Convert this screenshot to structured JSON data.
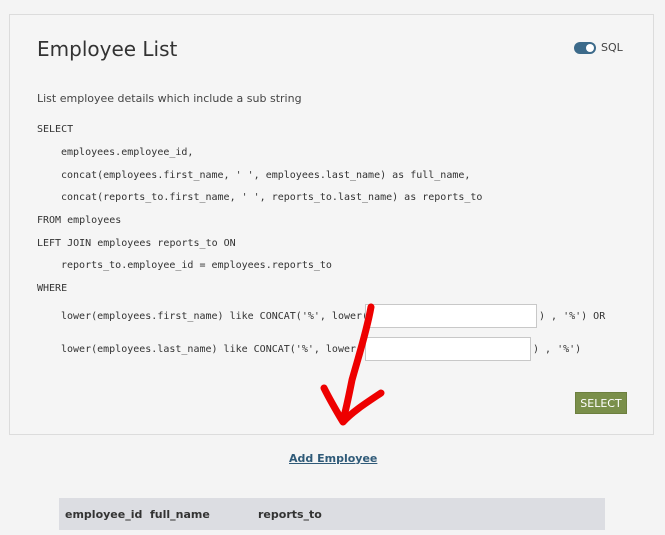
{
  "header": {
    "title": "Employee List"
  },
  "toggle": {
    "label": "SQL",
    "on": true
  },
  "description": "List employee details which include a sub string",
  "sql": {
    "line1": "SELECT",
    "line2": "employees.employee_id,",
    "line3": "concat(employees.first_name, ' ', employees.last_name) as full_name,",
    "line4": "concat(reports_to.first_name, ' ', reports_to.last_name) as reports_to",
    "line5": "FROM employees",
    "line6": "LEFT JOIN employees reports_to ON",
    "line7": "reports_to.employee_id = employees.reports_to",
    "line8": "WHERE",
    "where1_prefix": "lower(employees.first_name) like CONCAT('%', lower(",
    "where1_suffix": ") , '%') OR",
    "where2_prefix": "lower(employees.last_name) like CONCAT('%', lower(",
    "where2_suffix": ") , '%')"
  },
  "inputs": {
    "first_value": "",
    "last_value": ""
  },
  "buttons": {
    "select_label": "SELECT"
  },
  "links": {
    "add_employee": "Add Employee"
  },
  "table": {
    "columns": [
      "employee_id",
      "full_name",
      "reports_to"
    ]
  },
  "colors": {
    "accent": "#7a8f4a",
    "toggle": "#3c6a8a",
    "arrow": "#ee0000"
  }
}
